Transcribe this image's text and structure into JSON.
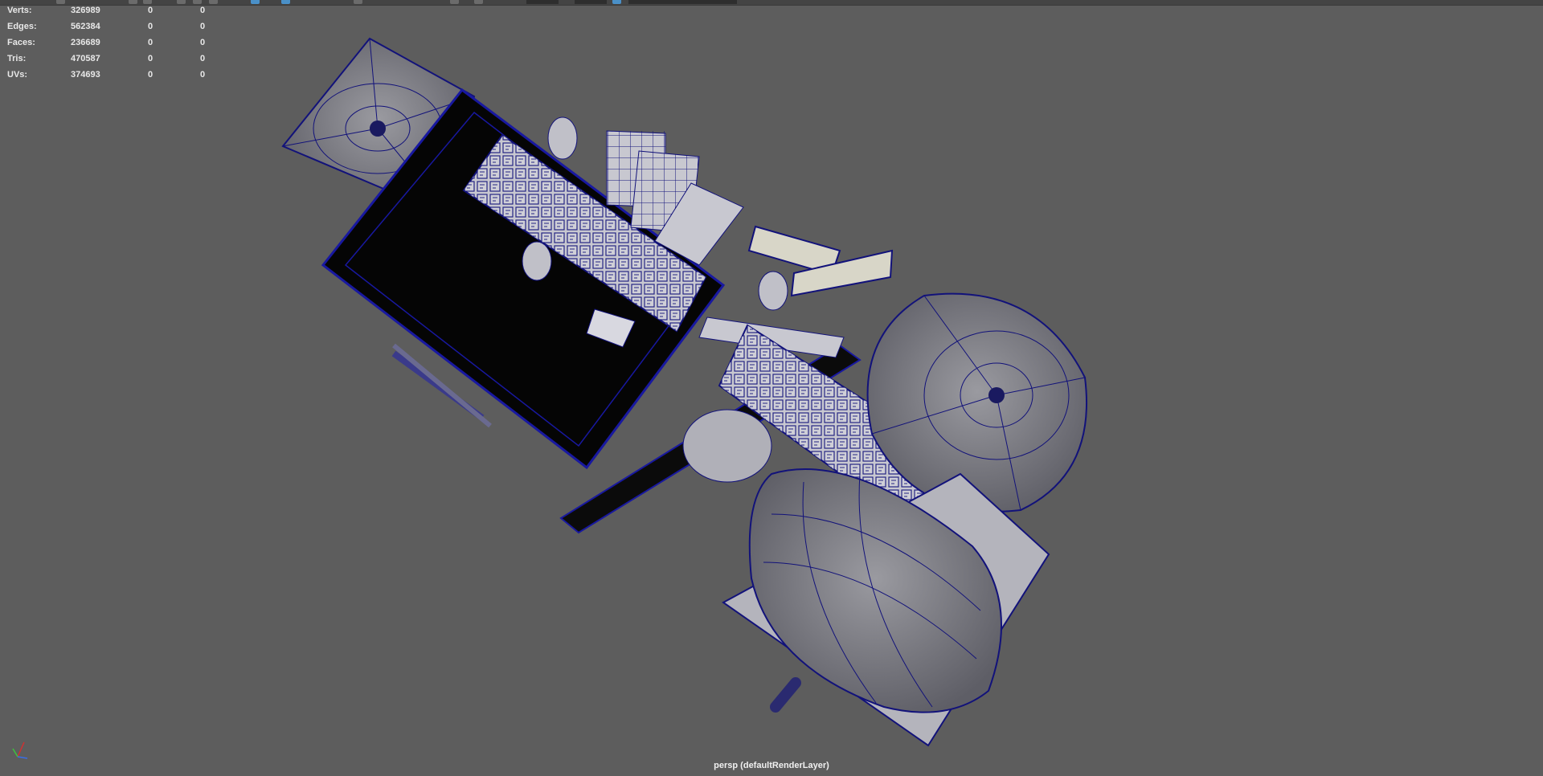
{
  "hud": {
    "rows": [
      {
        "label": "Verts:",
        "v1": "326989",
        "v2": "0",
        "v3": "0"
      },
      {
        "label": "Edges:",
        "v1": "562384",
        "v2": "0",
        "v3": "0"
      },
      {
        "label": "Faces:",
        "v1": "236689",
        "v2": "0",
        "v3": "0"
      },
      {
        "label": "Tris:",
        "v1": "470587",
        "v2": "0",
        "v3": "0"
      },
      {
        "label": "UVs:",
        "v1": "374693",
        "v2": "0",
        "v3": "0"
      }
    ]
  },
  "viewport": {
    "camera_label": "persp (defaultRenderLayer)",
    "wire_color": "#12127a",
    "mesh_color": "#b9b9c0",
    "background": "#5d5d5d"
  },
  "axis_gizmo": {
    "x_color": "#d23030",
    "y_color": "#3ec23e",
    "z_color": "#3a6ee8"
  },
  "toolbar": {
    "icons": [
      "select-icon",
      "lasso-icon",
      "paint-icon",
      "move-icon",
      "rotate-icon",
      "scale-icon",
      "snap-grid-icon",
      "snap-curve-icon",
      "snap-point-icon",
      "render-icon",
      "ipr-icon",
      "camera-icon"
    ]
  }
}
